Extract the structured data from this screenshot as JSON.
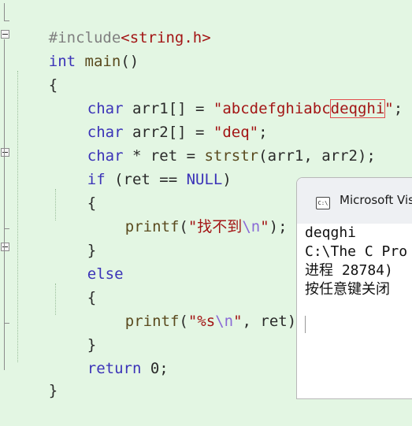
{
  "editor": {
    "lines": [
      {
        "include_kw": "#include",
        "include_file": "<string.h>"
      },
      {
        "type": "int",
        "name": "main",
        "parens": "()"
      },
      {
        "brace": "{"
      },
      {
        "type": "char",
        "decl": " arr1[] = ",
        "str_a": "\"abcdefghiabc",
        "str_b": "deqghi",
        "str_c": "\"",
        "end": ";"
      },
      {
        "type": "char",
        "decl": " arr2[] = ",
        "str": "\"deq\"",
        "end": ";"
      },
      {
        "type": "char",
        "decl": " * ret = ",
        "fn": "strstr",
        "args": "(arr1, arr2);"
      },
      {
        "kw": "if",
        "open": " (ret == ",
        "macro": "NULL",
        "close": ")"
      },
      {
        "brace": "{"
      },
      {
        "fn": "printf",
        "open": "(",
        "str_a": "\"找不到",
        "esc": "\\n",
        "str_b": "\"",
        "close": ");"
      },
      {
        "brace": "}"
      },
      {
        "kw": "else"
      },
      {
        "brace": "{"
      },
      {
        "fn": "printf",
        "open": "(",
        "str_a": "\"%s",
        "esc": "\\n",
        "str_b": "\"",
        "rest": ", ret);"
      },
      {
        "brace": "}"
      },
      {
        "kw": "return",
        "rest": " 0;"
      },
      {
        "brace": "}"
      }
    ]
  },
  "console": {
    "icon_label": "C:\\",
    "title": "Microsoft Vis",
    "output": [
      "deqghi",
      "",
      "C:\\The C Pro",
      "进程 28784)",
      "按任意键关闭"
    ]
  }
}
